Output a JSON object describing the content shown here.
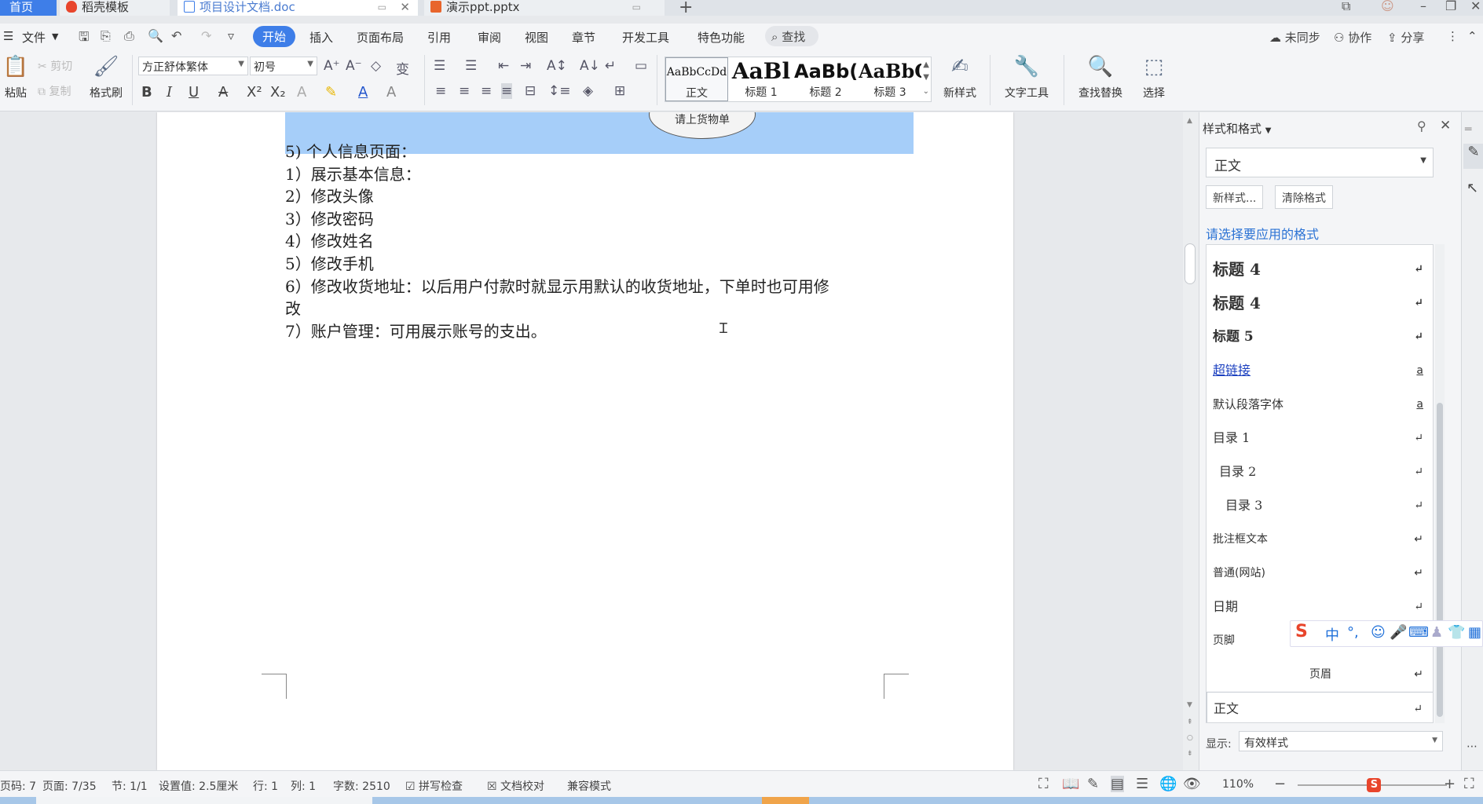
{
  "tabs": {
    "home": "首页",
    "items": [
      {
        "label": "稻壳模板",
        "icon": "daoke-icon",
        "color": "#e8452c"
      },
      {
        "label": "项目设计文档.doc",
        "icon": "word-doc-icon",
        "color": "#3e7ee8"
      },
      {
        "label": "演示ppt.pptx",
        "icon": "ppt-icon",
        "color": "#e8652c"
      }
    ],
    "new_tab": "+"
  },
  "menu": {
    "file": "文件",
    "items": [
      "开始",
      "插入",
      "页面布局",
      "引用",
      "审阅",
      "视图",
      "章节",
      "开发工具",
      "特色功能"
    ],
    "active": "开始",
    "search": "查找",
    "right": {
      "sync": "未同步",
      "collab": "协作",
      "share": "分享"
    }
  },
  "ribbon": {
    "paste": "粘贴",
    "cut": "剪切",
    "copy": "复制",
    "format_painter": "格式刷",
    "font_name": "方正舒体繁体",
    "font_size": "初号",
    "styles": [
      {
        "preview": "AaBbCcDd",
        "name": "正文"
      },
      {
        "preview": "AaBl",
        "name": "标题 1"
      },
      {
        "preview": "AaBb(",
        "name": "标题 2"
      },
      {
        "preview": "AaBbC",
        "name": "标题 3"
      }
    ],
    "new_style": "新样式",
    "text_tools": "文字工具",
    "find_replace": "查找替换",
    "select": "选择"
  },
  "document": {
    "ellipse_text": "请上货物单",
    "lines": [
      "5)   个人信息页面：",
      "1）展示基本信息：",
      "2）修改头像",
      "3）修改密码",
      "4）修改姓名",
      "5）修改手机",
      "6）修改收货地址：以后用户付款时就显示用默认的收货地址，下单时也可用修",
      "改",
      "7）账户管理：可用展示账号的支出。"
    ]
  },
  "styles_pane": {
    "title": "样式和格式",
    "current_style": "正文",
    "new_style_btn": "新样式...",
    "clear_format_btn": "清除格式",
    "prompt": "请选择要应用的格式",
    "items": [
      {
        "label": "标题  4",
        "mark": "↵"
      },
      {
        "label": "标题 4",
        "mark": "↵"
      },
      {
        "label": "标题 5",
        "mark": "↵"
      },
      {
        "label": "超链接",
        "mark": "a"
      },
      {
        "label": "默认段落字体",
        "mark": "a"
      },
      {
        "label": "目录  1",
        "mark": "↵"
      },
      {
        "label": "目录  2",
        "mark": "↵"
      },
      {
        "label": "目录  3",
        "mark": "↵"
      },
      {
        "label": "批注框文本",
        "mark": "↵"
      },
      {
        "label": "普通(网站)",
        "mark": "↵"
      },
      {
        "label": "日期",
        "mark": "↵"
      },
      {
        "label": "页脚",
        "mark": "↵"
      },
      {
        "label": "页眉",
        "mark": "↵"
      },
      {
        "label": "正文",
        "mark": "↵"
      }
    ],
    "show_label": "显示:",
    "show_value": "有效样式"
  },
  "ime": {
    "logo": "S",
    "mode": "中"
  },
  "status": {
    "page_code": "页码: 7",
    "page": "页面: 7/35",
    "section": "节: 1/1",
    "setting": "设置值: 2.5厘米",
    "row": "行: 1",
    "col": "列: 1",
    "word_count": "字数: 2510",
    "spell_check": "拼写检查",
    "proofread": "文档校对",
    "compat": "兼容模式",
    "zoom": "110%",
    "zoom_level": 1.1
  }
}
